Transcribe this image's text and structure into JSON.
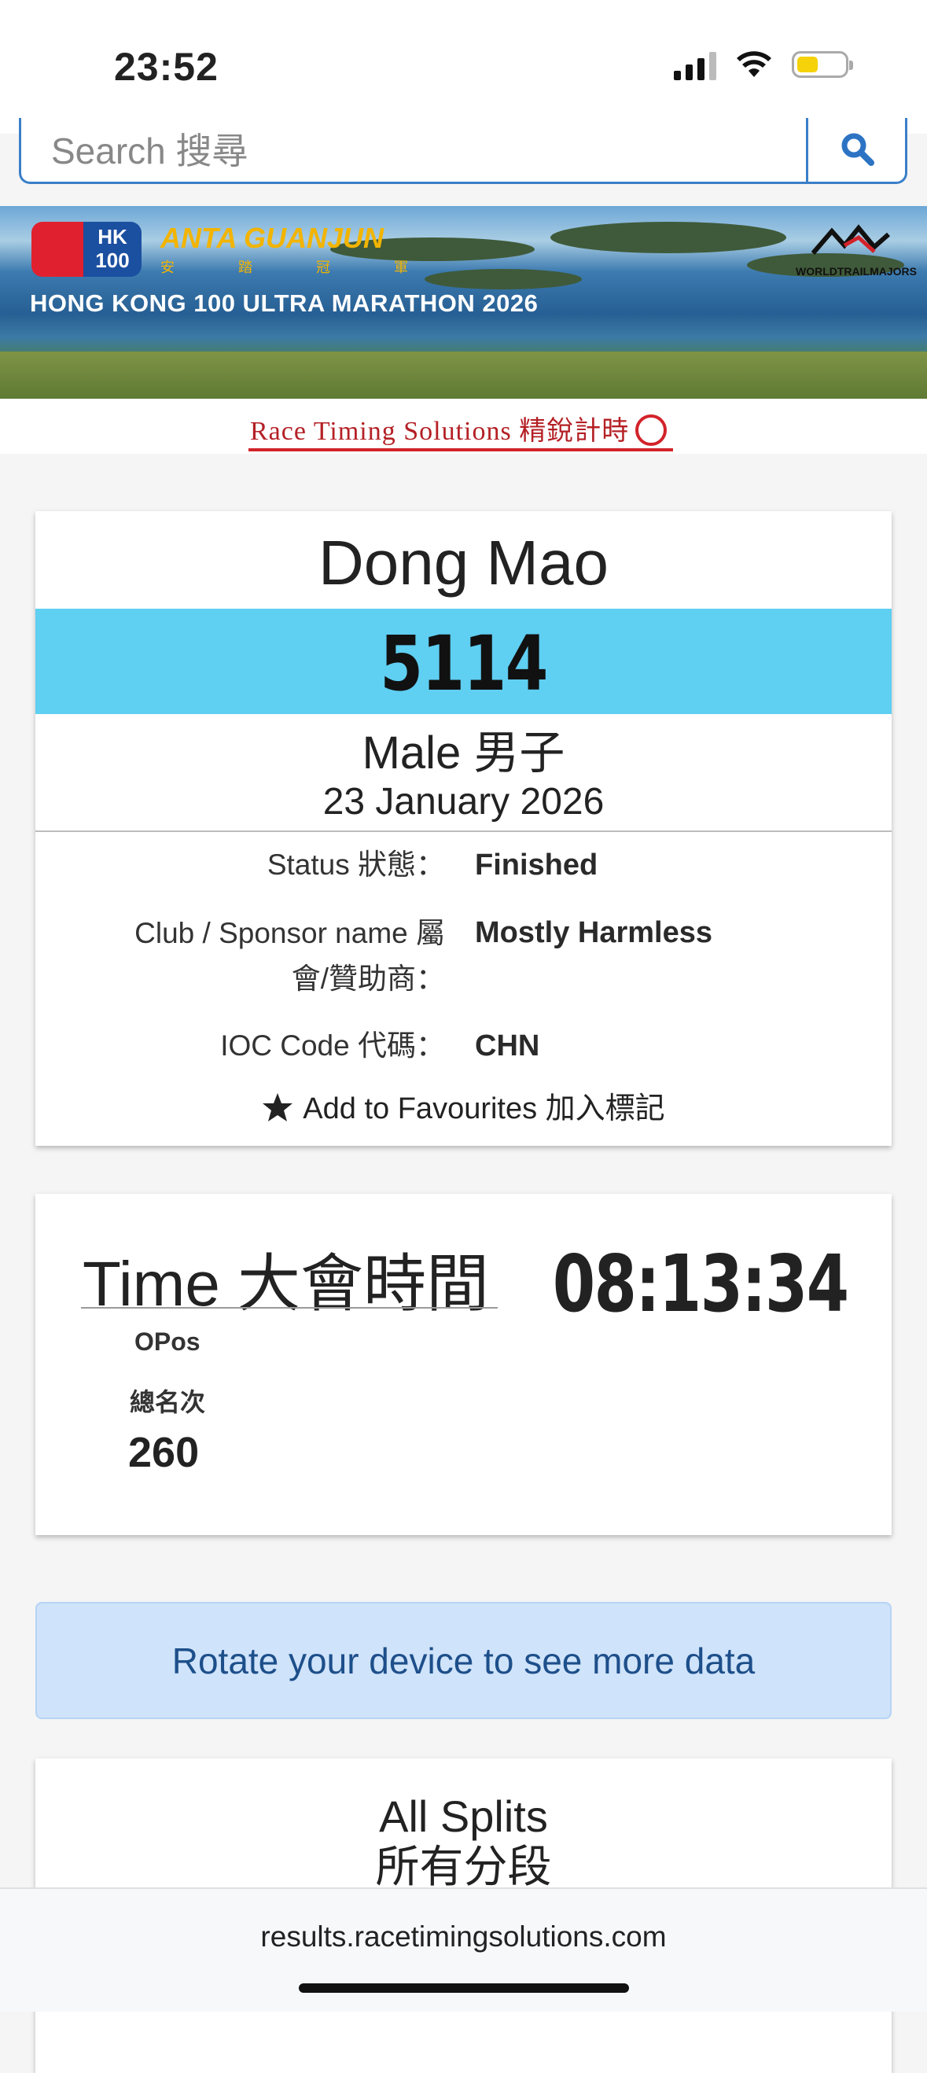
{
  "status_bar": {
    "time": "23:52"
  },
  "search": {
    "text": "Search 搜尋"
  },
  "banner": {
    "logo_text": "HK 100",
    "sponsor": "ANTA GUANJUN",
    "sponsor_cn": "安 踏 冠 軍",
    "title": "HONG KONG 100 ULTRA MARATHON 2026",
    "partner": "WORLDTRAILMAJORS"
  },
  "timing_brand": "Race Timing Solutions 精銳計時",
  "runner": {
    "name": "Dong Mao",
    "bib": "5114",
    "gender": "Male 男子",
    "date": "23 January 2026",
    "details": [
      {
        "label": "Status 狀態：",
        "value": "Finished"
      },
      {
        "label": "Club / Sponsor name 屬會/贊助商：",
        "value": "Mostly Harmless"
      },
      {
        "label": "IOC Code 代碼：",
        "value": "CHN"
      }
    ],
    "favourite": "Add to Favourites 加入標記"
  },
  "result": {
    "time_label": "Time 大會時間",
    "time_value": "08:13:34",
    "opos_label": "OPos",
    "opos_cn": "總名次",
    "opos_value": "260"
  },
  "notice": "Rotate your device to see more data",
  "splits": {
    "title_en": "All Splits",
    "title_cn": "所有分段"
  },
  "browser": {
    "url": "results.racetimingsolutions.com"
  },
  "colors": {
    "bib_band": "#5fcff2",
    "notice_bg": "#cfe3fa",
    "accent": "#3a7fc8"
  }
}
